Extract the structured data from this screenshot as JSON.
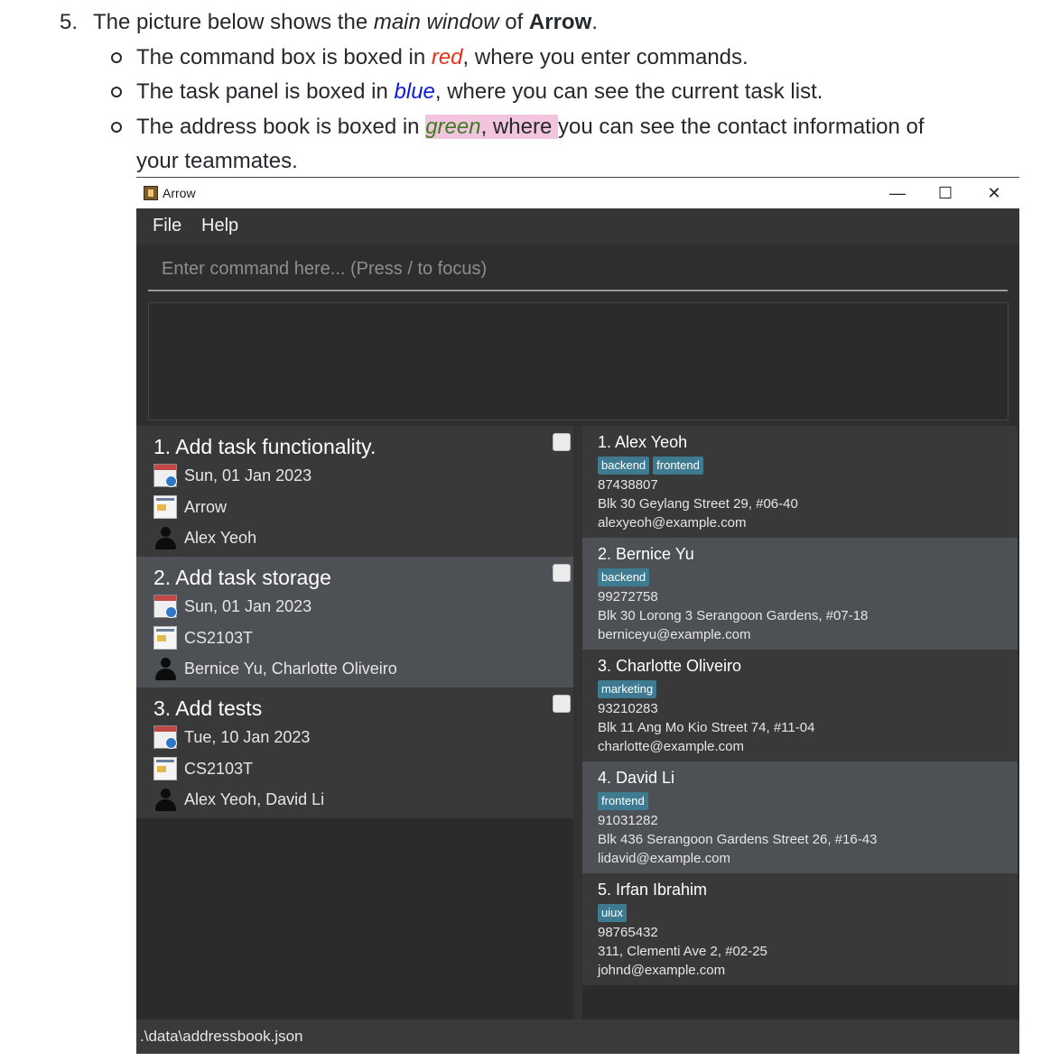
{
  "doc": {
    "step_number": "5.",
    "intro_before": "The picture below shows the ",
    "intro_italic": "main window",
    "intro_mid": " of ",
    "intro_bold": "Arrow",
    "intro_end": ".",
    "bullets": [
      {
        "before": "The command box is boxed in ",
        "color_word": "red",
        "after": ", where you enter commands."
      },
      {
        "before": "The task panel is boxed in ",
        "color_word": "blue",
        "after": ", where you can see the current task list."
      },
      {
        "before": "The address book is boxed in ",
        "color_word": "green",
        "highlight_after": ", where ",
        "after": "you can see the contact information of",
        "continuation": "your teammates."
      }
    ]
  },
  "window": {
    "title": "Arrow",
    "controls": {
      "minimize": "—",
      "maximize": "☐",
      "close": "✕"
    },
    "menu": [
      "File",
      "Help"
    ],
    "command_placeholder": "Enter command here... (Press / to focus)",
    "status_path": ".\\data\\addressbook.json"
  },
  "tasks": [
    {
      "title": "1. Add task functionality.",
      "date": "Sun, 01 Jan 2023",
      "project": "Arrow",
      "assignees": "Alex Yeoh",
      "done": false
    },
    {
      "title": "2. Add task storage",
      "date": "Sun, 01 Jan 2023",
      "project": "CS2103T",
      "assignees": "Bernice Yu, Charlotte Oliveiro",
      "done": false
    },
    {
      "title": "3. Add tests",
      "date": "Tue, 10 Jan 2023",
      "project": "CS2103T",
      "assignees": "Alex Yeoh, David Li",
      "done": false
    }
  ],
  "persons": [
    {
      "name": "1.  Alex Yeoh",
      "tags": [
        "backend",
        "frontend"
      ],
      "phone": "87438807",
      "address": "Blk 30 Geylang Street 29, #06-40",
      "email": "alexyeoh@example.com"
    },
    {
      "name": "2.  Bernice Yu",
      "tags": [
        "backend"
      ],
      "phone": "99272758",
      "address": "Blk 30 Lorong 3 Serangoon Gardens, #07-18",
      "email": "berniceyu@example.com"
    },
    {
      "name": "3.  Charlotte Oliveiro",
      "tags": [
        "marketing"
      ],
      "phone": "93210283",
      "address": "Blk 11 Ang Mo Kio Street 74, #11-04",
      "email": "charlotte@example.com"
    },
    {
      "name": "4.  David Li",
      "tags": [
        "frontend"
      ],
      "phone": "91031282",
      "address": "Blk 436 Serangoon Gardens Street 26, #16-43",
      "email": "lidavid@example.com"
    },
    {
      "name": "5.  Irfan Ibrahim",
      "tags": [
        "uiux"
      ],
      "phone": "98765432",
      "address": "311, Clementi Ave 2, #02-25",
      "email": "johnd@example.com"
    }
  ],
  "colors": {
    "red_word": "#e3331d",
    "blue_word": "#0b1bd6",
    "green_word": "#3a7d21",
    "highlight": "#f3c4dd",
    "tag_bg": "#3e7b91",
    "window_bg": "#2e2e2e"
  },
  "icons": [
    "app-icon",
    "calendar-icon",
    "project-icon",
    "person-icon"
  ]
}
